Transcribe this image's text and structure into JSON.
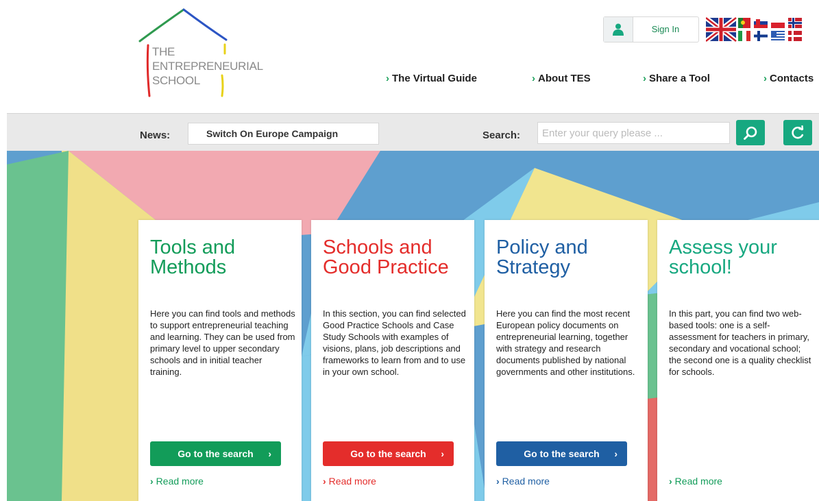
{
  "logo": {
    "line1": "THE",
    "line2": "ENTREPRENEURIAL",
    "line3": "SCHOOL"
  },
  "auth": {
    "sign_in": "Sign In",
    "icon": "user-icon"
  },
  "languages": [
    "en",
    "pt",
    "sk",
    "pl",
    "no",
    "it",
    "fi",
    "gr",
    "dk"
  ],
  "nav": {
    "chevron": "›",
    "items": [
      {
        "label": "The Virtual Guide"
      },
      {
        "label": "About TES"
      },
      {
        "label": "Share a Tool"
      },
      {
        "label": "Contacts"
      }
    ]
  },
  "news": {
    "label": "News:",
    "value": "Switch On Europe Campaign"
  },
  "search": {
    "label": "Search:",
    "placeholder": "Enter your query please ...",
    "button_icon": "search-icon",
    "refresh_icon": "refresh-icon"
  },
  "colors": {
    "green": "#129c59",
    "red": "#e42d2b",
    "blue": "#1f5fa3",
    "teal": "#17a880"
  },
  "cards": [
    {
      "title": "Tools and Methods",
      "text": "Here you can find tools and methods to support entrepreneurial teaching and learning. They can be used from primary level to upper secondary schools and in initial teacher training.",
      "button": "Go to the search",
      "arrow": "›",
      "read_more": "Read more"
    },
    {
      "title": "Schools and Good Practice",
      "text": "In this section, you can find selected Good Practice Schools and Case Study Schools with examples of visions, plans, job descriptions and frameworks to learn from and to use in your own school.",
      "button": "Go to the search",
      "arrow": "›",
      "read_more": "Read more"
    },
    {
      "title": "Policy and Strategy",
      "text": "Here you can find the most recent European policy documents on entrepreneurial learning, together with strategy and research documents published by national governments and other institutions.",
      "button": "Go to the search",
      "arrow": "›",
      "read_more": "Read more"
    },
    {
      "title": "Assess your school!",
      "text": "In this part, you can find two web-based tools: one is a self-assessment for teachers in primary, secondary and vocational school; the second one is a quality checklist for schools.",
      "arrow": "›",
      "read_more": "Read more"
    }
  ]
}
